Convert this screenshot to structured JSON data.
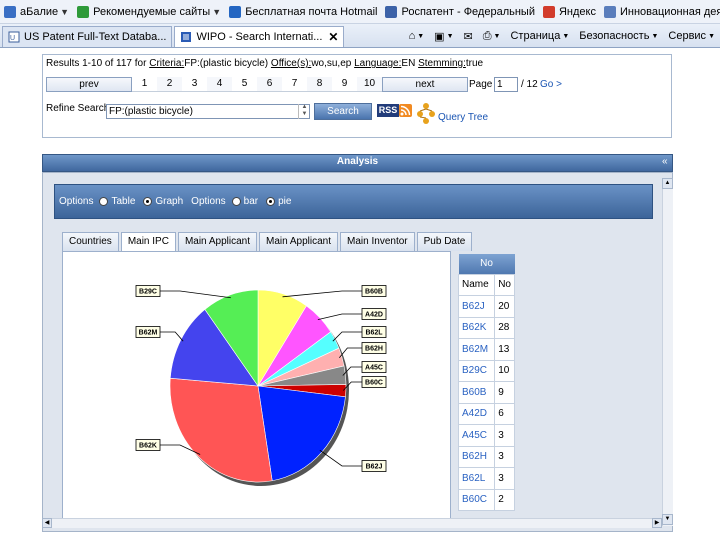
{
  "favorites": [
    {
      "label": "аБалие",
      "color": "#3a6fc4"
    },
    {
      "label": "Рекомендуемые сайты",
      "color": "#2e9a3a"
    },
    {
      "label": "Бесплатная почта Hotmail",
      "color": "#2466c2"
    },
    {
      "label": "Роспатент - Федеральный",
      "color": "#3c62a8"
    },
    {
      "label": "Яндекс",
      "color": "#d23b2b"
    },
    {
      "label": "Инновационная деятельн...",
      "color": "#5b7ebc"
    }
  ],
  "tabs": [
    {
      "label": "US Patent Full-Text Databa..."
    },
    {
      "label": "WIPO - Search Internati..."
    }
  ],
  "commands": [
    "Страница",
    "Безопасность",
    "Сервис"
  ],
  "results": {
    "prefix": "Results 1-10 of 117 for",
    "criteria_label": "Criteria:",
    "criteria_value": "FP:(plastic bicycle)",
    "office_label": "Office(s):",
    "office_value": "wo,su,ep",
    "language_label": "Language:",
    "language_value": "EN",
    "stemming_label": "Stemming:",
    "stemming_value": "true"
  },
  "pager": {
    "prev": "prev",
    "next": "next",
    "pages": [
      "1",
      "2",
      "3",
      "4",
      "5",
      "6",
      "7",
      "8",
      "9",
      "10"
    ],
    "page_label": "Page",
    "page_value": "1",
    "page_total": "/ 12",
    "go": "Go >"
  },
  "refine": {
    "label": "Refine Search",
    "value": "FP:(plastic bicycle)",
    "search_button": "Search",
    "rss": "RSS",
    "query_tree": "Query Tree"
  },
  "analysis": {
    "title": "Analysis",
    "collapse": "«",
    "options1_label": "Options",
    "opt_table": "Table",
    "opt_graph": "Graph",
    "options2_label": "Options",
    "opt_bar": "bar",
    "opt_pie": "pie",
    "selected_view": "Graph",
    "selected_chart": "pie"
  },
  "inner_tabs": [
    "Countries",
    "Main IPC",
    "Main Applicant",
    "Main Applicant",
    "Main Inventor",
    "Pub Date"
  ],
  "active_inner_tab": 1,
  "table": {
    "top_header": "No",
    "col_name": "Name",
    "col_no": "No",
    "rows": [
      {
        "name": "B62J",
        "no": "20"
      },
      {
        "name": "B62K",
        "no": "28"
      },
      {
        "name": "B62M",
        "no": "13"
      },
      {
        "name": "B29C",
        "no": "10"
      },
      {
        "name": "B60B",
        "no": "9"
      },
      {
        "name": "A42D",
        "no": "6"
      },
      {
        "name": "A45C",
        "no": "3"
      },
      {
        "name": "B62H",
        "no": "3"
      },
      {
        "name": "B62L",
        "no": "3"
      },
      {
        "name": "B60C",
        "no": "2"
      }
    ]
  },
  "chart_data": {
    "type": "pie",
    "categories": [
      "B60B",
      "A42D",
      "B62L",
      "B62H",
      "A45C",
      "B60C",
      "B62J",
      "B62K",
      "B62M",
      "B29C"
    ],
    "values": [
      9,
      6,
      3,
      3,
      3,
      2,
      20,
      28,
      13,
      10
    ],
    "colors": [
      "#ffff66",
      "#ff55ff",
      "#55ffff",
      "#ffb0b0",
      "#888888",
      "#cc0000",
      "#0022ff",
      "#ff5555",
      "#4444ee",
      "#55ee55"
    ],
    "legend": "callout labels around pie"
  }
}
